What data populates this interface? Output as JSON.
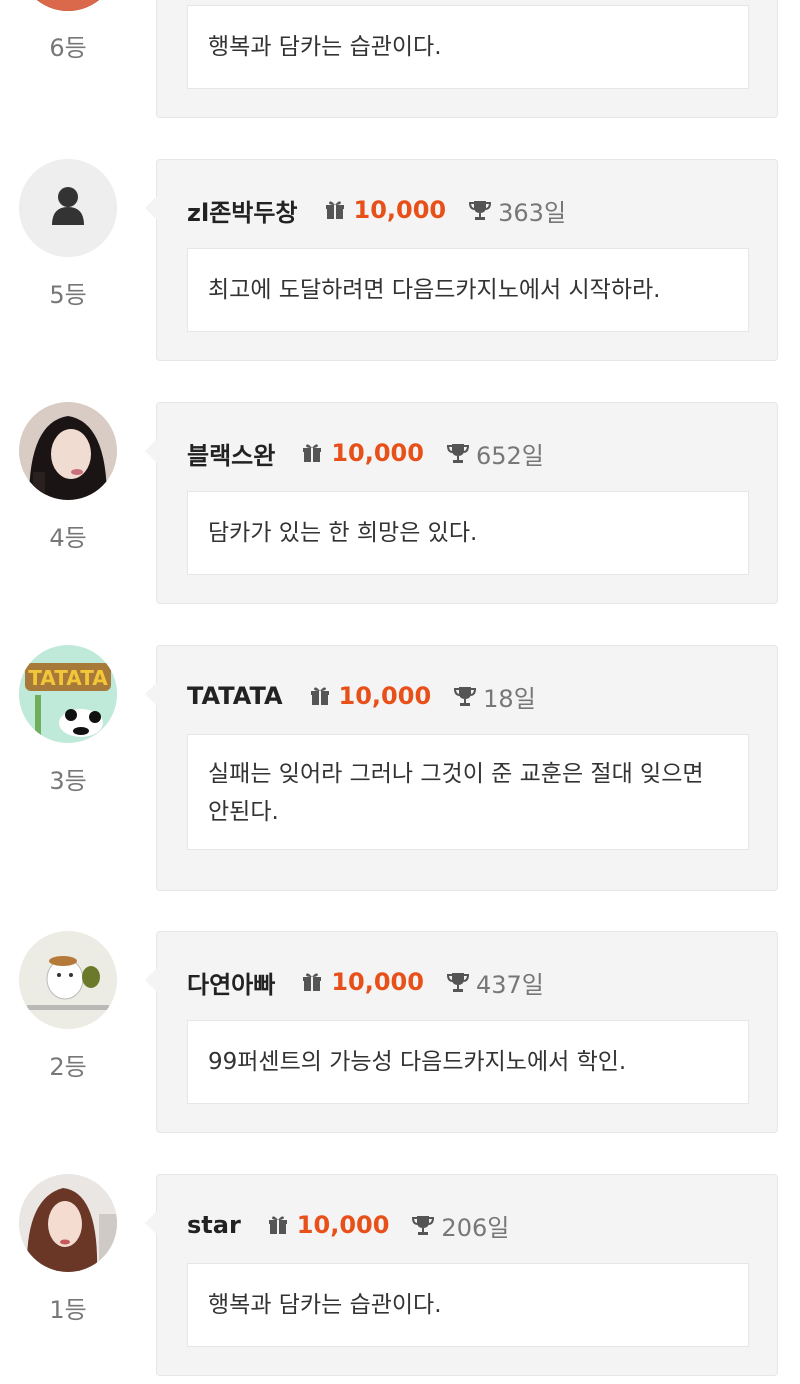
{
  "ranking": [
    {
      "rank_label": "6등",
      "message": "행복과 담카는 습관이다.",
      "avatar": "red-photo-avatar"
    },
    {
      "rank_label": "5등",
      "nickname": "zl존박두창",
      "points": "10,000",
      "days": "363일",
      "message": "최고에 도달하려면 다음드카지노에서 시작하라.",
      "avatar": "default-person-avatar"
    },
    {
      "rank_label": "4등",
      "nickname": "블랙스완",
      "points": "10,000",
      "days": "652일",
      "message": "담카가 있는 한 희망은 있다.",
      "avatar": "woman-photo-avatar"
    },
    {
      "rank_label": "3등",
      "nickname": "TATATA",
      "points": "10,000",
      "days": "18일",
      "message": "실패는 잊어라 그러나 그것이 준 교훈은 절대 잊으면 안된다.",
      "avatar": "tatata-panda-avatar",
      "avatar_text": "TATATA"
    },
    {
      "rank_label": "2등",
      "nickname": "다연아빠",
      "points": "10,000",
      "days": "437일",
      "message": "99퍼센트의 가능성 다음드카지노에서 학인.",
      "avatar": "cartoon-hamster-avatar"
    },
    {
      "rank_label": "1등",
      "nickname": "star",
      "points": "10,000",
      "days": "206일",
      "message": "행복과 담카는 습관이다.",
      "avatar": "woman-portrait-avatar"
    }
  ],
  "colors": {
    "points": "#e8501a",
    "bubble_bg": "#f4f4f4",
    "rank_text": "#777777"
  }
}
